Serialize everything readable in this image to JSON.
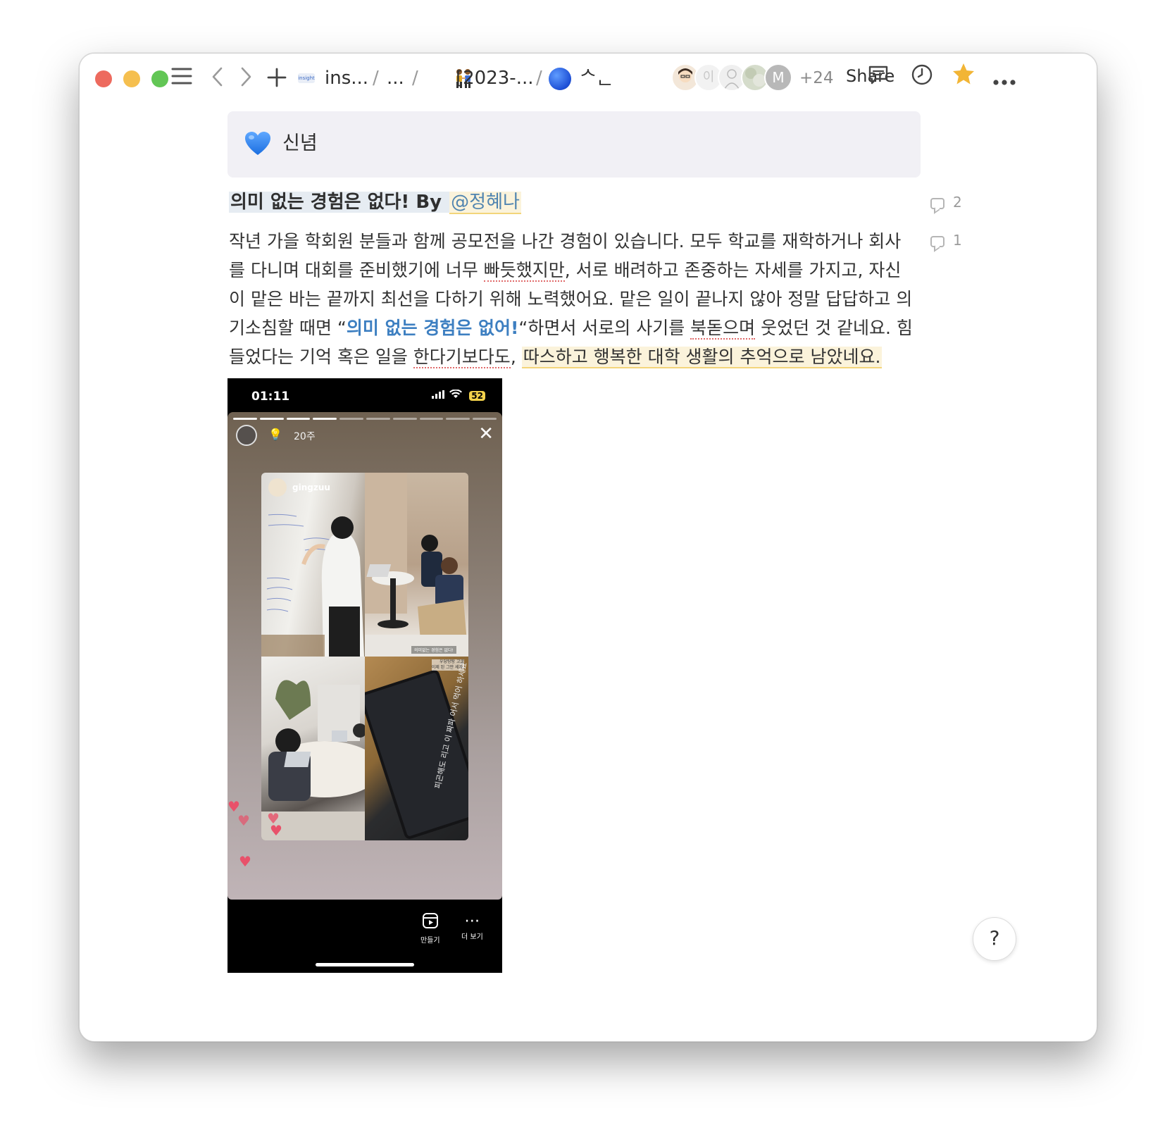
{
  "topbar": {
    "breadcrumbs": [
      {
        "label": "ins...",
        "icon": "insight-logo"
      },
      {
        "label": "..."
      },
      {
        "label": "[2023-...",
        "icon": "people-holding-hands-emoji"
      },
      {
        "label": "ᄉᆫ",
        "icon": "blue-circle-emoji"
      }
    ],
    "separator": "/",
    "avatar_letters": [
      "이",
      "M"
    ],
    "collaborator_count": "+24",
    "share_label": "Share"
  },
  "callout": {
    "icon": "blue-heart-emoji",
    "text": "신념",
    "background": "#f1f0f5"
  },
  "heading": {
    "text": "의미 없는 경험은 없다! By ",
    "mention": "@정혜나",
    "comment_count": "2"
  },
  "paragraph": {
    "comment_count": "1",
    "line1": "작년 가을 학회원 분들과 함께 공모전을 나간 경험이 있습니다. 모두 학교를 재학하거나 회사",
    "line2_a": "를 다니며 대회를 준비했기에 너무 ",
    "line2_b": "빠듯했지만",
    "line2_c": ", 서로 배려하고 존중하는 자세를 가지고, 자신",
    "line3": "이 맡은 바는 끝까지 최선을 다하기 위해 노력했어요. 맡은 일이 끝나지 않아 정말 답답하고 의",
    "line4_a": "기소침할 때면  “",
    "line4_link": "의미 없는 경험은 없어!",
    "line4_b": "“하면서 서로의 사기를 ",
    "line4_c": "북돋으며",
    "line4_d": " 웃었던 것 같네요. 힘",
    "line5_a": "들었다는 기억 혹은 일을 ",
    "line5_b": "한다기보다도",
    "line5_c": ", ",
    "line5_hl": "따스하고 행복한 대학 생활의 추억으로 남았네요."
  },
  "phone": {
    "time": "01:11",
    "battery": "52",
    "story_age": "20주",
    "collage_username": "gingzuu",
    "whiteboard_caption": "",
    "cell2_caption": "의미없는 경험은 없다!",
    "cell4_caption_1": "우당탕탕 고굴",
    "cell4_caption_2": "이제 된 그만 세자.",
    "tablet_text": "피곤해도 리고 이 짜파 어서 먹어 하세요",
    "create_label": "만들기",
    "more_label": "더 보기"
  },
  "help": {
    "label": "?"
  }
}
